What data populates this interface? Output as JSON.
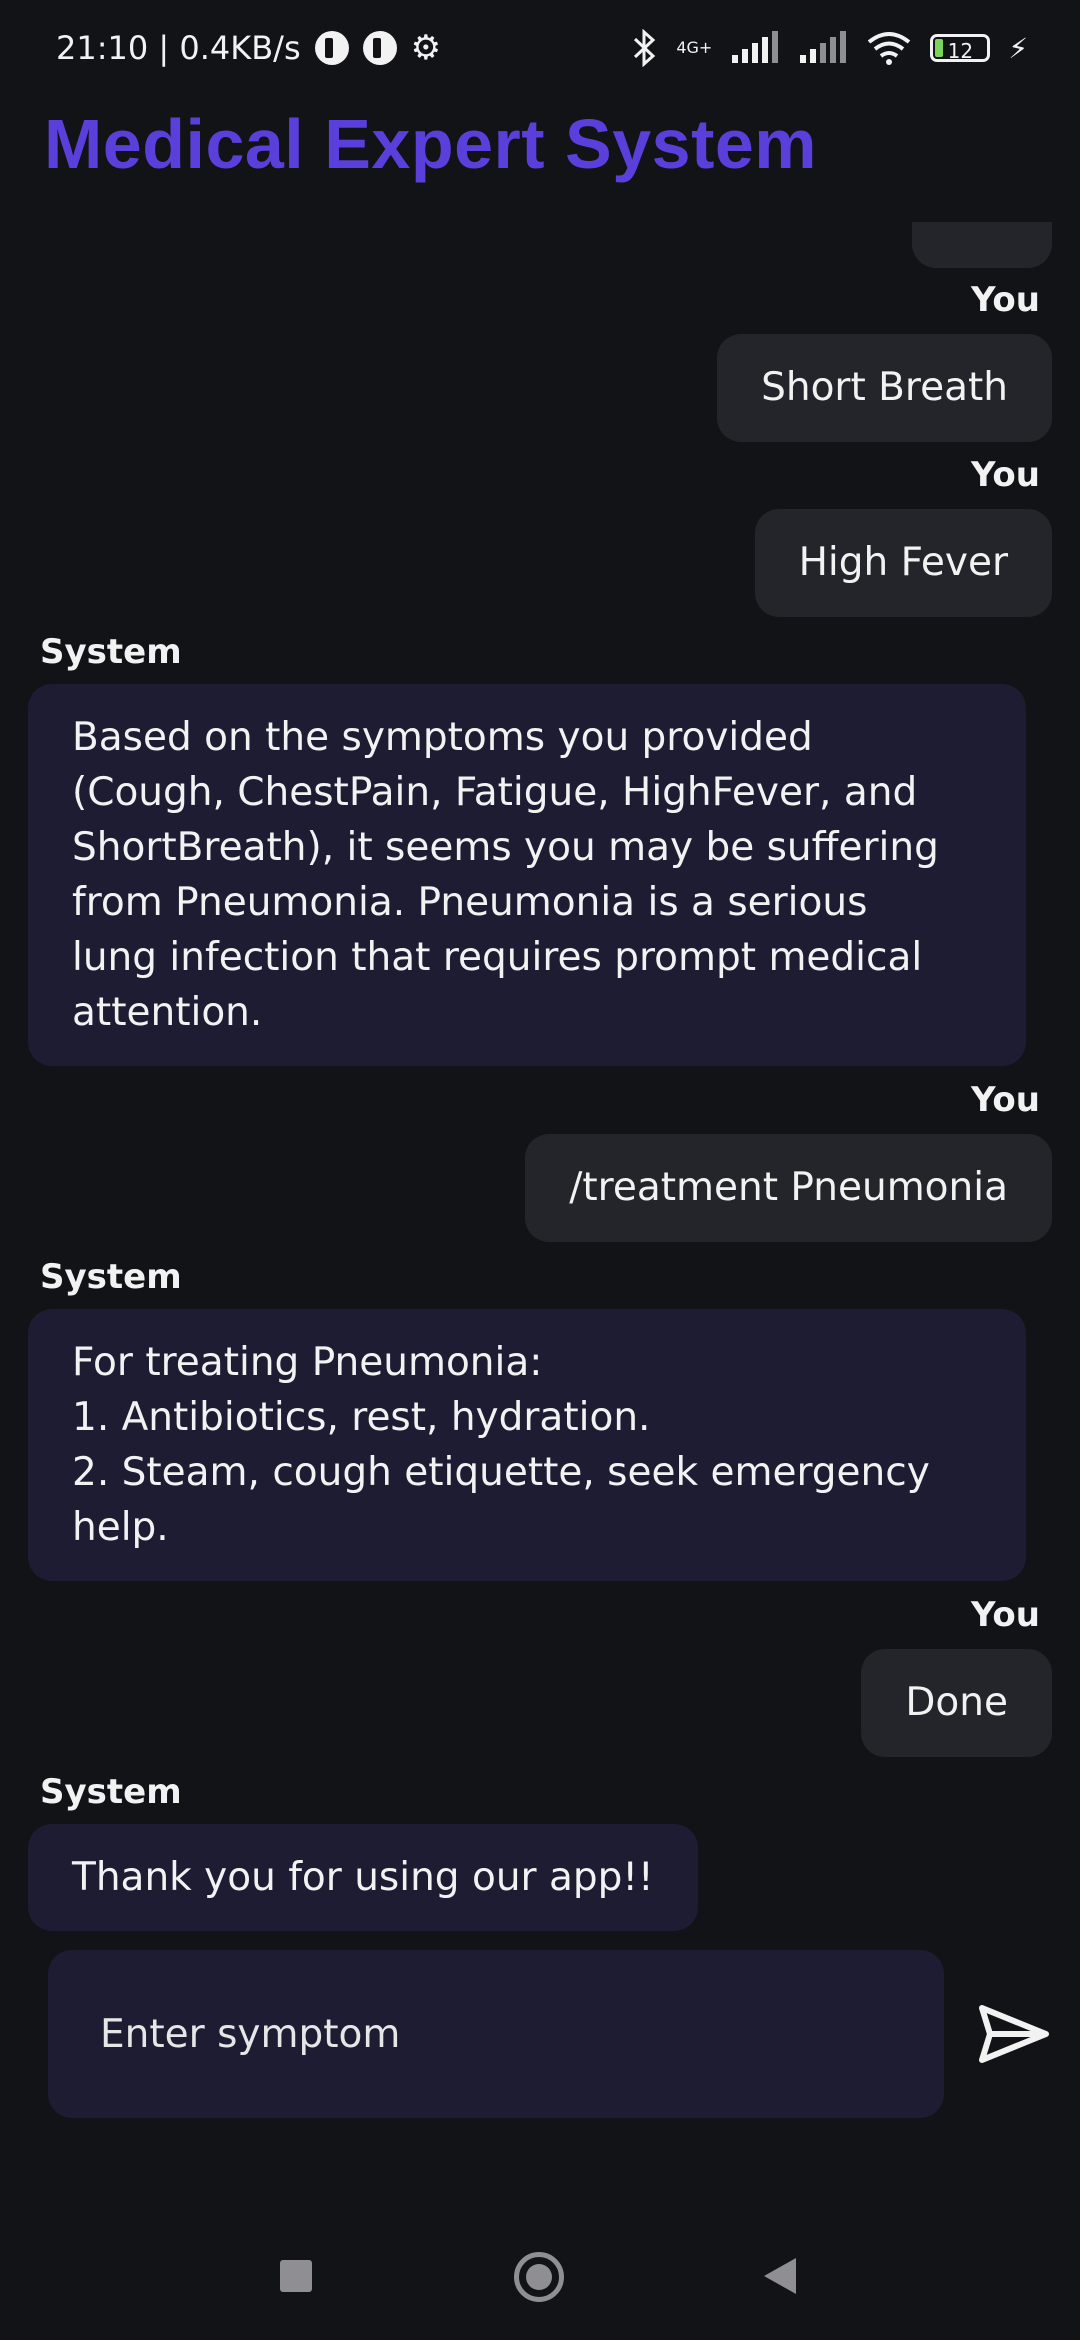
{
  "status_bar": {
    "time_speed": "21:10 | 0.4KB/s",
    "network_type": "4G+",
    "battery_level": "12",
    "icons": [
      "app-notification-icon",
      "app-notification-icon",
      "gear-icon",
      "bluetooth-icon",
      "signal-icon",
      "signal-icon",
      "wifi-icon",
      "battery-icon",
      "charging-icon"
    ]
  },
  "app": {
    "title": "Medical Expert System",
    "accent_color": "#5B3FDB"
  },
  "chat": {
    "you_label": "You",
    "system_label": "System",
    "messages": [
      {
        "sender": "You",
        "text": "Short Breath"
      },
      {
        "sender": "You",
        "text": "High Fever"
      },
      {
        "sender": "System",
        "text": "Based on the symptoms you provided\n(Cough, ChestPain, Fatigue, HighFever, and\nShortBreath), it seems you may be suffering\nfrom Pneumonia. Pneumonia is a serious\nlung infection that requires prompt medical\nattention."
      },
      {
        "sender": "You",
        "text": "/treatment Pneumonia"
      },
      {
        "sender": "System",
        "text": "For treating Pneumonia:\n1. Antibiotics, rest, hydration.\n2. Steam, cough etiquette, seek emergency\nhelp."
      },
      {
        "sender": "You",
        "text": "Done"
      },
      {
        "sender": "System",
        "text": "Thank you for using our app!!"
      }
    ]
  },
  "input": {
    "placeholder": "Enter symptom",
    "value": ""
  }
}
